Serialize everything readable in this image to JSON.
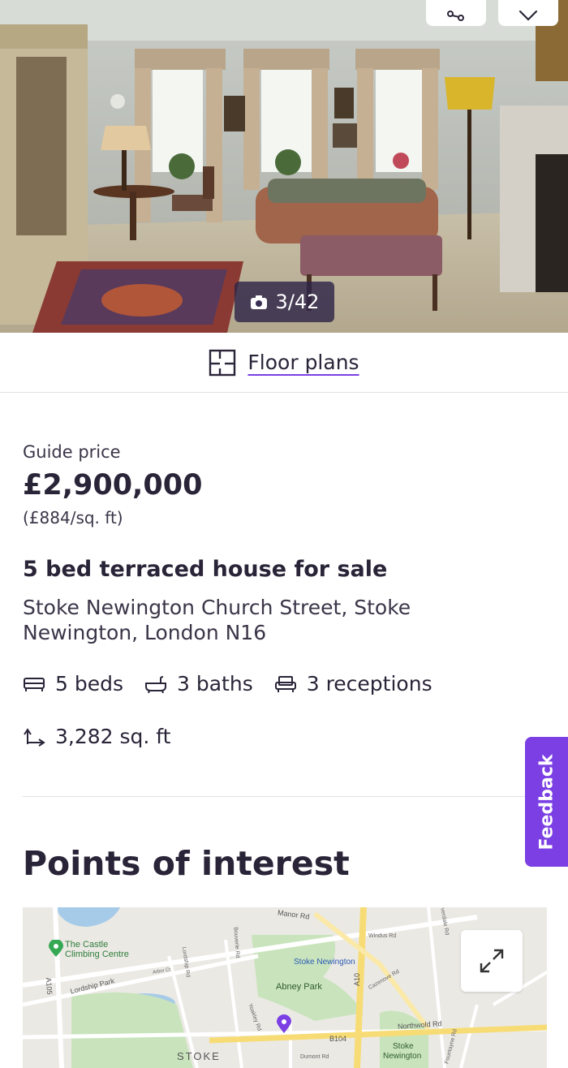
{
  "gallery": {
    "counter": "3/42"
  },
  "floor_plans": {
    "label": "Floor plans"
  },
  "listing": {
    "price_label": "Guide price",
    "price": "£2,900,000",
    "price_per_sqft": "(£884/sq. ft)",
    "title": "5 bed terraced house for sale",
    "address": "Stoke Newington Church Street, Stoke Newington, London N16",
    "features": {
      "beds": "5 beds",
      "baths": "3 baths",
      "receptions": "3 receptions"
    },
    "area": "3,282 sq. ft"
  },
  "points_of_interest": {
    "heading": "Points of interest"
  },
  "feedback": {
    "label": "Feedback"
  },
  "map": {
    "labels": {
      "manor_rd": "Manor Rd",
      "castle": "The Castle",
      "climbing": "Climbing Centre",
      "lordship_park": "Lordship Park",
      "stoke_newington_station": "Stoke Newington",
      "abney_park": "Abney Park",
      "northwold_rd": "Northwold Rd",
      "b104": "B104",
      "a10": "A10",
      "a105": "A105",
      "stoke": "STOKE",
      "stoke_newington_common_1": "Stoke",
      "stoke_newington_common_2": "Newington",
      "windus_rd": "Windus Rd",
      "bouverie_rd": "Bouverie Rd",
      "lordship_rd": "Lordship Rd",
      "yoakley_rd": "Yoakley Rd",
      "dumont_rd": "Dumont Rd",
      "cazenove_rd": "Cazenove Rd",
      "fountayne_rd": "Fountayne Rd",
      "kyverdale_rd": "Kyverdale Rd",
      "arbor_ct": "Arbor Ct"
    }
  },
  "colors": {
    "accent": "#7b3fe4",
    "text": "#2a2438",
    "counter_bg": "#2e2448"
  }
}
